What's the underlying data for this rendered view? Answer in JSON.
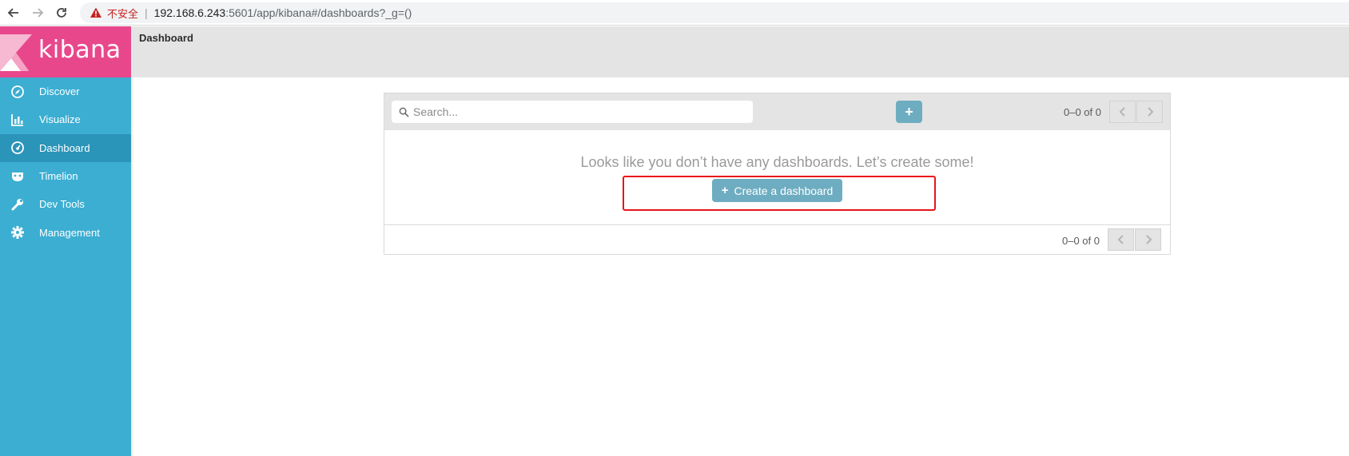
{
  "browser": {
    "insecure_label": "不安全",
    "host": "192.168.6.243",
    "path": ":5601/app/kibana#/dashboards?_g=()"
  },
  "sidebar": {
    "logo_text": "kibana",
    "items": [
      {
        "label": "Discover",
        "icon": "compass-icon"
      },
      {
        "label": "Visualize",
        "icon": "bar-chart-icon"
      },
      {
        "label": "Dashboard",
        "icon": "dashboard-gauge-icon",
        "active": true
      },
      {
        "label": "Timelion",
        "icon": "timelion-mask-icon"
      },
      {
        "label": "Dev Tools",
        "icon": "wrench-icon"
      },
      {
        "label": "Management",
        "icon": "gear-icon"
      }
    ]
  },
  "topbar": {
    "title": "Dashboard"
  },
  "panel": {
    "search_placeholder": "Search...",
    "add_label": "+",
    "pager_top": "0–0 of 0",
    "empty_message": "Looks like you don’t have any dashboards. Let’s create some!",
    "create_button_label": "Create a dashboard",
    "pager_bottom": "0–0 of 0"
  },
  "colors": {
    "sidebar": "#3caed2",
    "sidebar_active": "#2b94b9",
    "logo": "#e8488b",
    "button": "#6eadc1",
    "highlight": "#e8141a"
  }
}
